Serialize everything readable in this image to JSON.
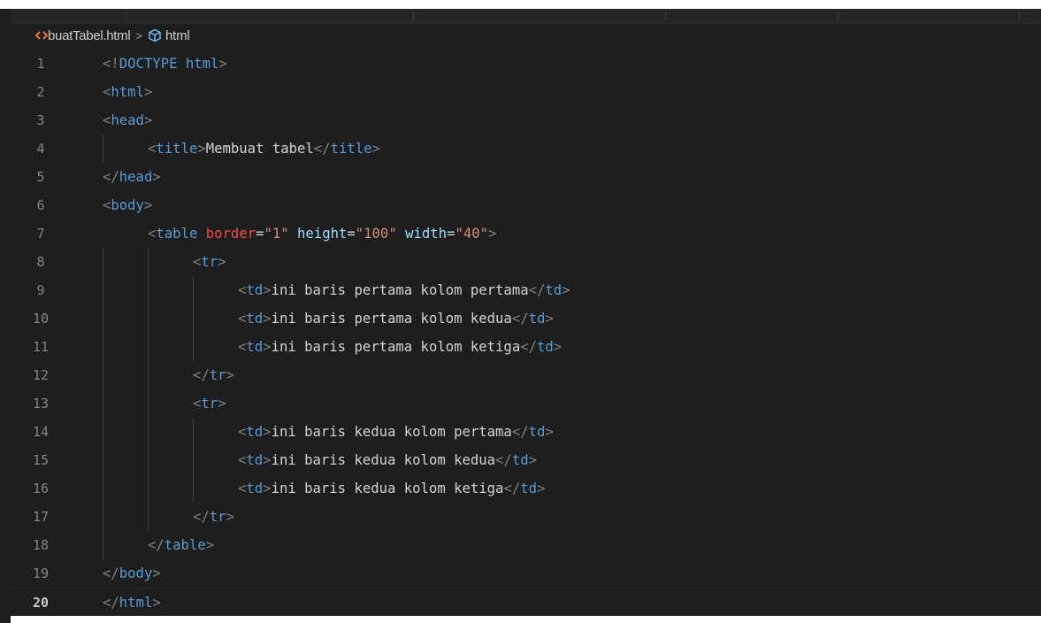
{
  "breadcrumb": {
    "file": "buatTabel.html",
    "separator": ">",
    "element": "html"
  },
  "editor": {
    "current_line": 20,
    "lines": [
      {
        "n": "1",
        "indent": 0,
        "tokens": [
          [
            "punc",
            "<!"
          ],
          [
            "doctype",
            "DOCTYPE"
          ],
          [
            "text",
            " "
          ],
          [
            "tag",
            "html"
          ],
          [
            "punc",
            ">"
          ]
        ]
      },
      {
        "n": "2",
        "indent": 0,
        "tokens": [
          [
            "punc",
            "<"
          ],
          [
            "tag",
            "html"
          ],
          [
            "punc",
            ">"
          ]
        ]
      },
      {
        "n": "3",
        "indent": 0,
        "tokens": [
          [
            "punc",
            "<"
          ],
          [
            "tag",
            "head"
          ],
          [
            "punc",
            ">"
          ]
        ]
      },
      {
        "n": "4",
        "indent": 1,
        "tokens": [
          [
            "punc",
            "<"
          ],
          [
            "tag",
            "title"
          ],
          [
            "punc",
            ">"
          ],
          [
            "text",
            "Membuat tabel"
          ],
          [
            "punc",
            "</"
          ],
          [
            "tag",
            "title"
          ],
          [
            "punc",
            ">"
          ]
        ]
      },
      {
        "n": "5",
        "indent": 0,
        "tokens": [
          [
            "punc",
            "</"
          ],
          [
            "tag",
            "head"
          ],
          [
            "punc",
            ">"
          ]
        ]
      },
      {
        "n": "6",
        "indent": 0,
        "tokens": [
          [
            "punc",
            "<"
          ],
          [
            "tag",
            "body"
          ],
          [
            "punc",
            ">"
          ]
        ]
      },
      {
        "n": "7",
        "indent": 1,
        "tokens": [
          [
            "punc",
            "<"
          ],
          [
            "tag",
            "table"
          ],
          [
            "text",
            " "
          ],
          [
            "attrerr",
            "border"
          ],
          [
            "text",
            "="
          ],
          [
            "str",
            "\"1\""
          ],
          [
            "text",
            " "
          ],
          [
            "attr",
            "height"
          ],
          [
            "text",
            "="
          ],
          [
            "str",
            "\"100\""
          ],
          [
            "text",
            " "
          ],
          [
            "attr",
            "width"
          ],
          [
            "text",
            "="
          ],
          [
            "str",
            "\"40\""
          ],
          [
            "punc",
            ">"
          ]
        ]
      },
      {
        "n": "8",
        "indent": 2,
        "tokens": [
          [
            "punc",
            "<"
          ],
          [
            "tag",
            "tr"
          ],
          [
            "punc",
            ">"
          ]
        ]
      },
      {
        "n": "9",
        "indent": 3,
        "tokens": [
          [
            "punc",
            "<"
          ],
          [
            "tag",
            "td"
          ],
          [
            "punc",
            ">"
          ],
          [
            "text",
            "ini baris pertama kolom pertama"
          ],
          [
            "punc",
            "</"
          ],
          [
            "tag",
            "td"
          ],
          [
            "punc",
            ">"
          ]
        ]
      },
      {
        "n": "10",
        "indent": 3,
        "tokens": [
          [
            "punc",
            "<"
          ],
          [
            "tag",
            "td"
          ],
          [
            "punc",
            ">"
          ],
          [
            "text",
            "ini baris pertama kolom kedua"
          ],
          [
            "punc",
            "</"
          ],
          [
            "tag",
            "td"
          ],
          [
            "punc",
            ">"
          ]
        ]
      },
      {
        "n": "11",
        "indent": 3,
        "tokens": [
          [
            "punc",
            "<"
          ],
          [
            "tag",
            "td"
          ],
          [
            "punc",
            ">"
          ],
          [
            "text",
            "ini baris pertama kolom ketiga"
          ],
          [
            "punc",
            "</"
          ],
          [
            "tag",
            "td"
          ],
          [
            "punc",
            ">"
          ]
        ]
      },
      {
        "n": "12",
        "indent": 2,
        "tokens": [
          [
            "punc",
            "</"
          ],
          [
            "tag",
            "tr"
          ],
          [
            "punc",
            ">"
          ]
        ]
      },
      {
        "n": "13",
        "indent": 2,
        "tokens": [
          [
            "punc",
            "<"
          ],
          [
            "tag",
            "tr"
          ],
          [
            "punc",
            ">"
          ]
        ]
      },
      {
        "n": "14",
        "indent": 3,
        "tokens": [
          [
            "punc",
            "<"
          ],
          [
            "tag",
            "td"
          ],
          [
            "punc",
            ">"
          ],
          [
            "text",
            "ini baris kedua kolom pertama"
          ],
          [
            "punc",
            "</"
          ],
          [
            "tag",
            "td"
          ],
          [
            "punc",
            ">"
          ]
        ]
      },
      {
        "n": "15",
        "indent": 3,
        "tokens": [
          [
            "punc",
            "<"
          ],
          [
            "tag",
            "td"
          ],
          [
            "punc",
            ">"
          ],
          [
            "text",
            "ini baris kedua kolom kedua"
          ],
          [
            "punc",
            "</"
          ],
          [
            "tag",
            "td"
          ],
          [
            "punc",
            ">"
          ]
        ]
      },
      {
        "n": "16",
        "indent": 3,
        "tokens": [
          [
            "punc",
            "<"
          ],
          [
            "tag",
            "td"
          ],
          [
            "punc",
            ">"
          ],
          [
            "text",
            "ini baris kedua kolom ketiga"
          ],
          [
            "punc",
            "</"
          ],
          [
            "tag",
            "td"
          ],
          [
            "punc",
            ">"
          ]
        ]
      },
      {
        "n": "17",
        "indent": 2,
        "tokens": [
          [
            "punc",
            "</"
          ],
          [
            "tag",
            "tr"
          ],
          [
            "punc",
            ">"
          ]
        ]
      },
      {
        "n": "18",
        "indent": 1,
        "tokens": [
          [
            "punc",
            "</"
          ],
          [
            "tag",
            "table"
          ],
          [
            "punc",
            ">"
          ]
        ]
      },
      {
        "n": "19",
        "indent": 0,
        "tokens": [
          [
            "punc",
            "</"
          ],
          [
            "tag",
            "body"
          ],
          [
            "punc",
            ">"
          ]
        ]
      },
      {
        "n": "20",
        "indent": 0,
        "tokens": [
          [
            "punc",
            "</"
          ],
          [
            "tag",
            "html"
          ],
          [
            "punc",
            ">"
          ]
        ]
      }
    ]
  },
  "colors": {
    "background": "#1e1e1e",
    "tag": "#569cd6",
    "punctuation": "#808080",
    "attribute": "#9cdcfe",
    "attribute_error": "#f44747",
    "string": "#ce9178",
    "text": "#d4d4d4",
    "line_number": "#858585"
  },
  "icons": {
    "file": "html-file-icon",
    "element": "cube-icon"
  }
}
